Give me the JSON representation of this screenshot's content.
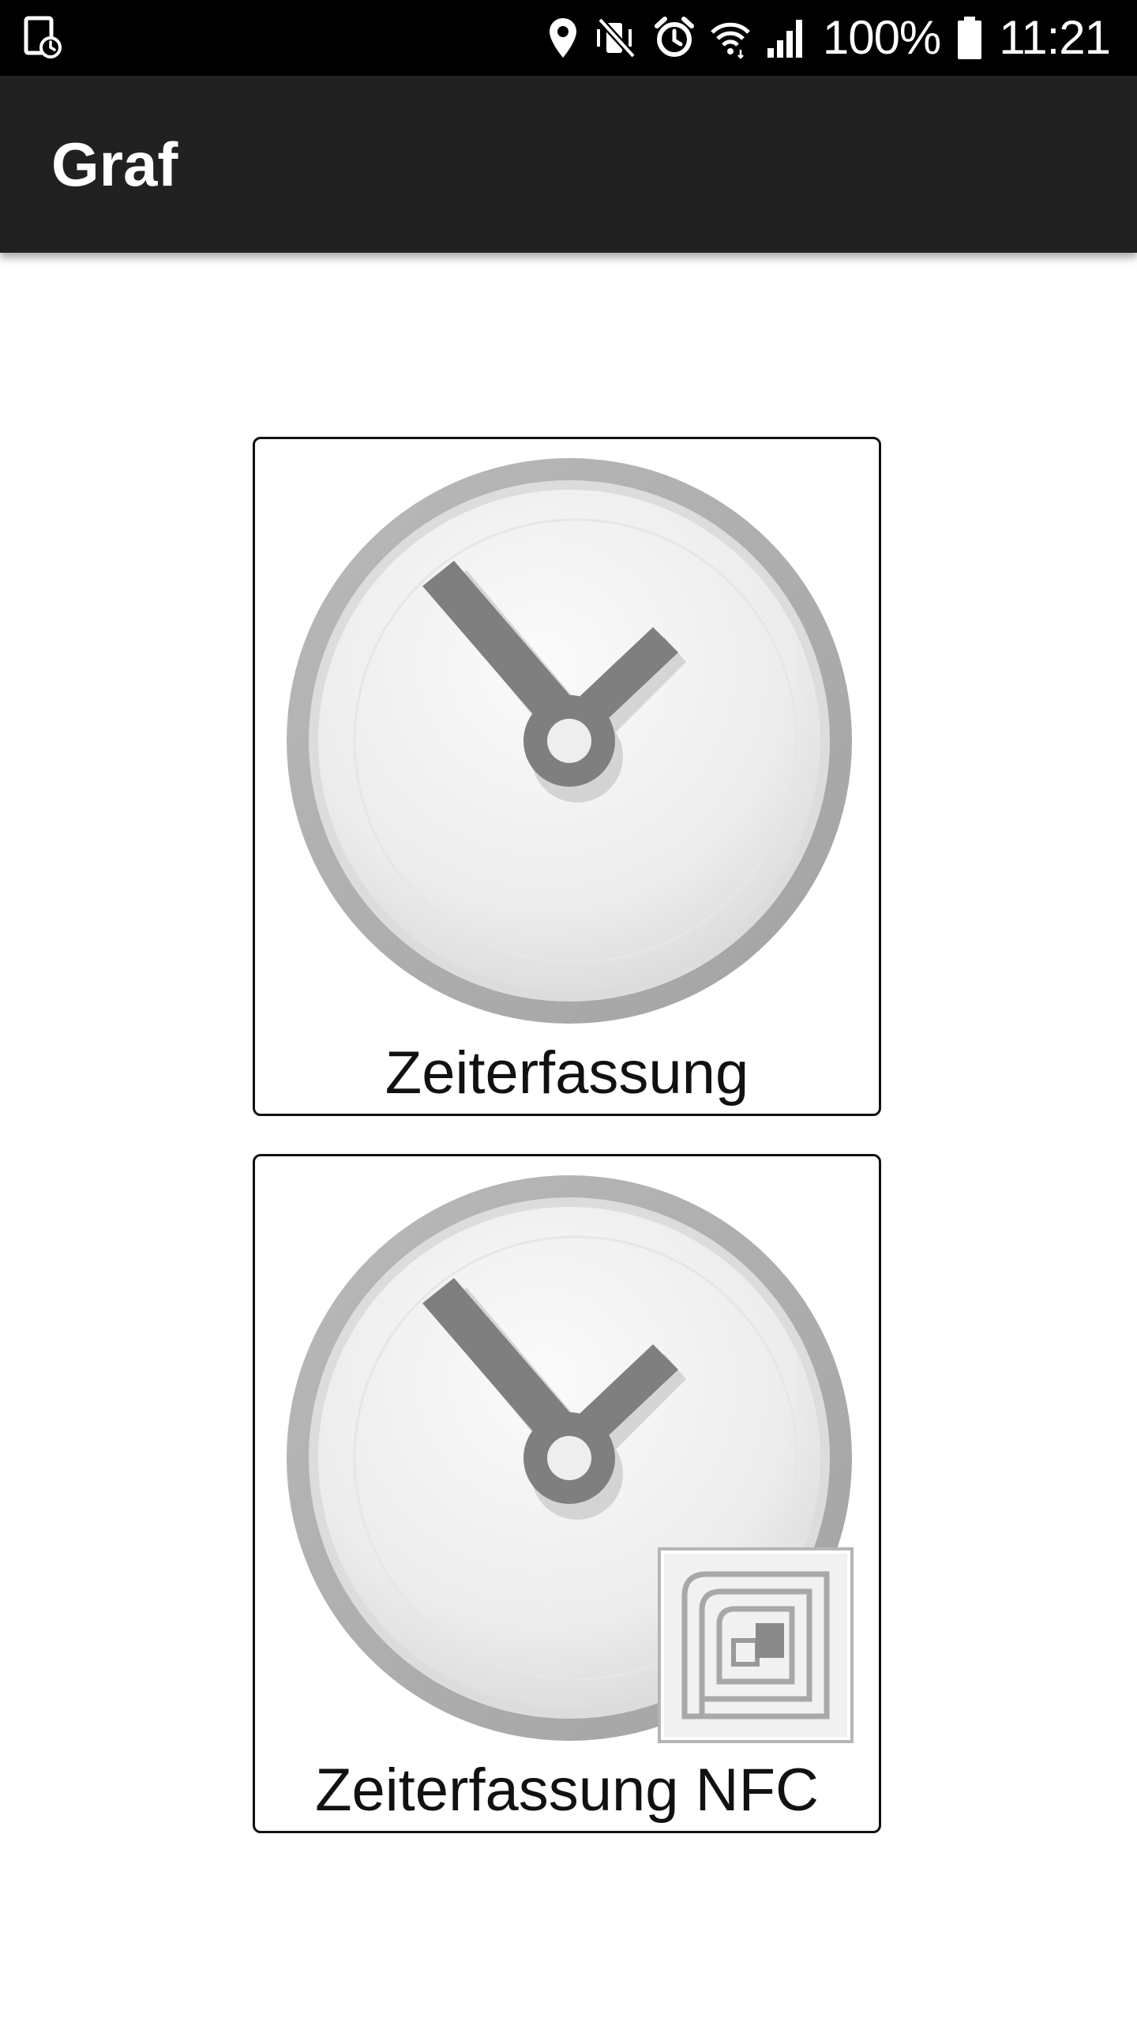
{
  "status_bar": {
    "battery_percent": "100%",
    "time": "11:21",
    "icons": [
      "screenshot-notification-icon",
      "location-icon",
      "vibrate-mute-icon",
      "alarm-icon",
      "wifi-icon",
      "signal-icon",
      "battery-icon"
    ]
  },
  "app_bar": {
    "title": "Graf"
  },
  "tiles": [
    {
      "label": "Zeiterfassung",
      "icon": "clock-icon"
    },
    {
      "label": "Zeiterfassung NFC",
      "icon": "clock-icon",
      "badge": "nfc-tag-icon"
    }
  ],
  "colors": {
    "status_bar": "#000000",
    "app_bar": "#212121",
    "background": "#ffffff",
    "tile_border": "#111111",
    "clock_hands": "#808080"
  }
}
